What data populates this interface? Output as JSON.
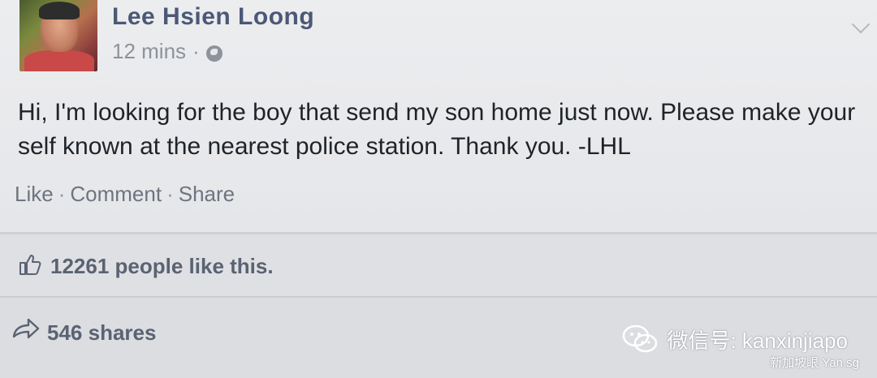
{
  "post": {
    "author": "Lee Hsien Loong",
    "time": "12 mins",
    "separator": "·",
    "text": "Hi, I'm looking for the boy that send my son home just now. Please make your self known at the nearest police station. Thank you. -LHL"
  },
  "actions": {
    "like": "Like",
    "comment": "Comment",
    "share": "Share",
    "separator": "·"
  },
  "stats": {
    "likes": "12261 people like this.",
    "shares": "546 shares"
  },
  "watermark": {
    "main": "微信号: kanxinjiapo",
    "sub": "新加坡眼 Yan.sg"
  },
  "icons": {
    "audience": "globe-icon",
    "menu": "chevron-down-icon",
    "likes": "thumbs-up-icon",
    "shares": "share-arrow-icon",
    "watermark": "wechat-icon"
  },
  "colors": {
    "author": "#4b5876",
    "background": "#e9eaec",
    "text": "#1f2329"
  }
}
